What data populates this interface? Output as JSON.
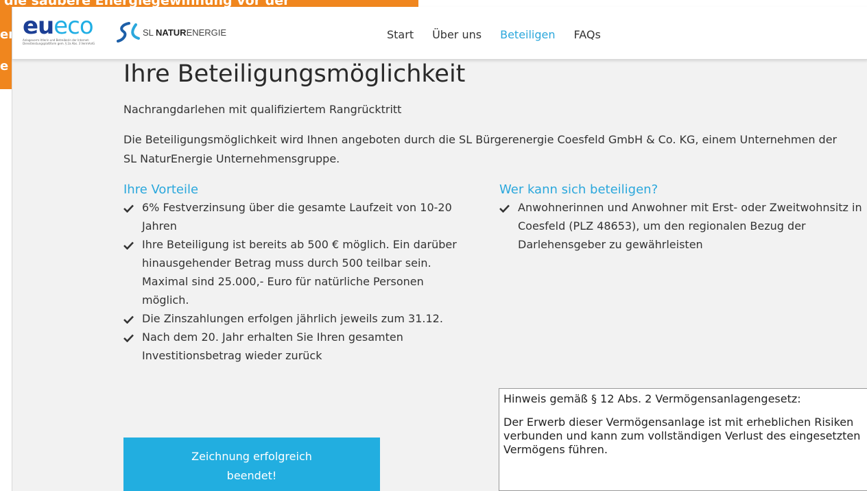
{
  "background": {
    "banner_text": "die saubere Energiegewinnung vor der",
    "fragment_1": "er",
    "fragment_2": "e",
    "color": "#f0861e"
  },
  "header": {
    "logo_eueco": {
      "part1": "eu",
      "part2": "eco",
      "tagline": "Anlageverm ittlerin und Betreiberin der Internet-Dienstleistungsplattform gem. § 2a Abs. 3 VermAnlG"
    },
    "logo_sl": {
      "prefix": "SL ",
      "bold": "NATUR",
      "suffix": "ENERGIE"
    },
    "nav": [
      {
        "label": "Start",
        "active": false
      },
      {
        "label": "Über uns",
        "active": false
      },
      {
        "label": "Beteiligen",
        "active": true
      },
      {
        "label": "FAQs",
        "active": false
      }
    ]
  },
  "main": {
    "title": "Ihre Beteiligungsmöglichkeit",
    "subtitle": "Nachrangdarlehen mit qualifiziertem Rangrücktritt",
    "intro": "Die Beteiligungsmöglichkeit wird Ihnen angeboten durch die SL Bürgerenergie Coesfeld GmbH & Co. KG, einem Unternehmen der SL NaturEnergie Unternehmensgruppe.",
    "advantages": {
      "heading": "Ihre Vorteile",
      "items": [
        "6% Festverzinsung über die gesamte Laufzeit von 10-20 Jahren",
        "Ihre Beteiligung ist bereits ab 500 € möglich. Ein darüber hinausgehender Betrag muss durch 500 teilbar sein. Maximal sind 25.000,- Euro für natürliche Personen möglich.",
        "Die Zinszahlungen erfolgen jährlich jeweils zum 31.12.",
        "Nach dem 20. Jahr erhalten Sie Ihren gesamten Investitionsbetrag wieder zurück"
      ]
    },
    "eligibility": {
      "heading": "Wer kann sich beteiligen?",
      "items": [
        "Anwohnerinnen und Anwohner mit Erst- oder Zweitwohnsitz in Coesfeld (PLZ 48653), um den regionalen Bezug der Darlehensgeber zu gewährleisten"
      ]
    },
    "notice": {
      "line1": "Hinweis gemäß § 12 Abs. 2 Vermögensanlagengesetz:",
      "line2": "Der Erwerb dieser Vermögensanlage ist mit erheblichen Risiken verbunden und kann zum vollständigen Verlust des eingesetzten Vermögens führen."
    },
    "cta_label": "Zeichnung erfolgreich beendet!"
  },
  "colors": {
    "accent": "#2aa7dc",
    "button": "#22aee0",
    "eu_blue": "#1c3f95"
  },
  "icons": {
    "list_bullet": "checkmark-icon",
    "sl_logo": "sl-swoosh-icon"
  }
}
